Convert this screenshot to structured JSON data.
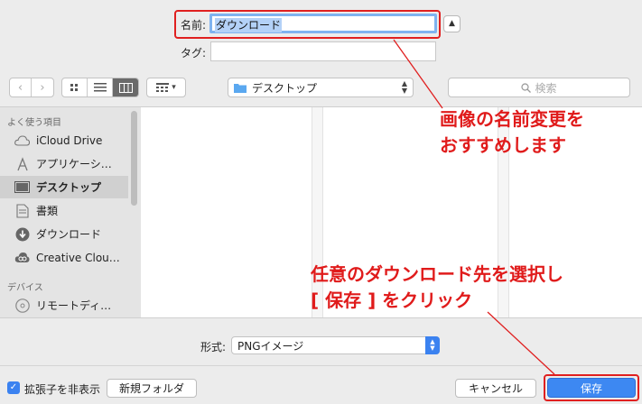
{
  "save_panel": {
    "name_label": "名前:",
    "name_value": "ダウンロード",
    "tag_label": "タグ:",
    "tag_value": ""
  },
  "toolbar": {
    "location": "デスクトップ",
    "search_placeholder": "検索"
  },
  "sidebar": {
    "favorites_heading": "よく使う項目",
    "devices_heading": "デバイス",
    "items": [
      {
        "label": "iCloud Drive",
        "icon": "cloud-icon"
      },
      {
        "label": "アプリケーシ…",
        "icon": "applications-icon"
      },
      {
        "label": "デスクトップ",
        "icon": "desktop-icon",
        "selected": true
      },
      {
        "label": "書類",
        "icon": "document-icon"
      },
      {
        "label": "ダウンロード",
        "icon": "download-icon"
      },
      {
        "label": "Creative Clou…",
        "icon": "creative-cloud-icon"
      }
    ],
    "devices": [
      {
        "label": "リモートディ…",
        "icon": "disc-icon"
      }
    ]
  },
  "format": {
    "label": "形式:",
    "value": "PNGイメージ"
  },
  "footer": {
    "hide_extension_label": "拡張子を非表示",
    "hide_extension_checked": true,
    "new_folder_label": "新規フォルダ",
    "cancel_label": "キャンセル",
    "save_label": "保存"
  },
  "annotations": {
    "rename_line1": "画像の名前変更を",
    "rename_line2": "おすすめします",
    "select_line1": "任意のダウンロード先を選択し",
    "select_line2": "[ 保存 ] をクリック",
    "color": "#e01b1b"
  },
  "colors": {
    "accent": "#3d88f2",
    "highlight": "#e02020"
  }
}
